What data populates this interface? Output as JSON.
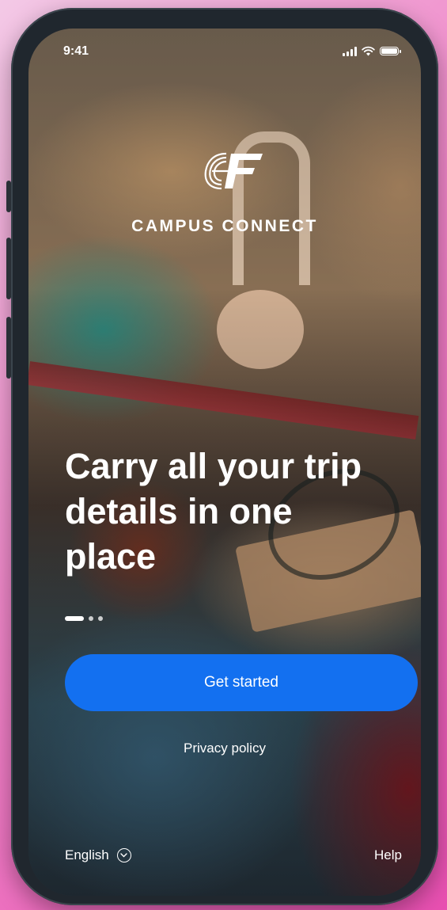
{
  "status_bar": {
    "time": "9:41"
  },
  "app": {
    "name": "CAMPUS CONNECT",
    "logo_text": "EF"
  },
  "onboarding": {
    "headline": "Carry all your trip details in one place",
    "pager": {
      "pages": 3,
      "active": 1
    }
  },
  "actions": {
    "get_started_label": "Get started",
    "privacy_label": "Privacy policy"
  },
  "footer": {
    "language_label": "English",
    "help_label": "Help"
  },
  "colors": {
    "primary_button": "#1370f0",
    "background_accent": "#e84fb1"
  },
  "icons": [
    "signal-icon",
    "wifi-icon",
    "battery-icon",
    "chevron-down-icon",
    "ef-logo-icon"
  ]
}
